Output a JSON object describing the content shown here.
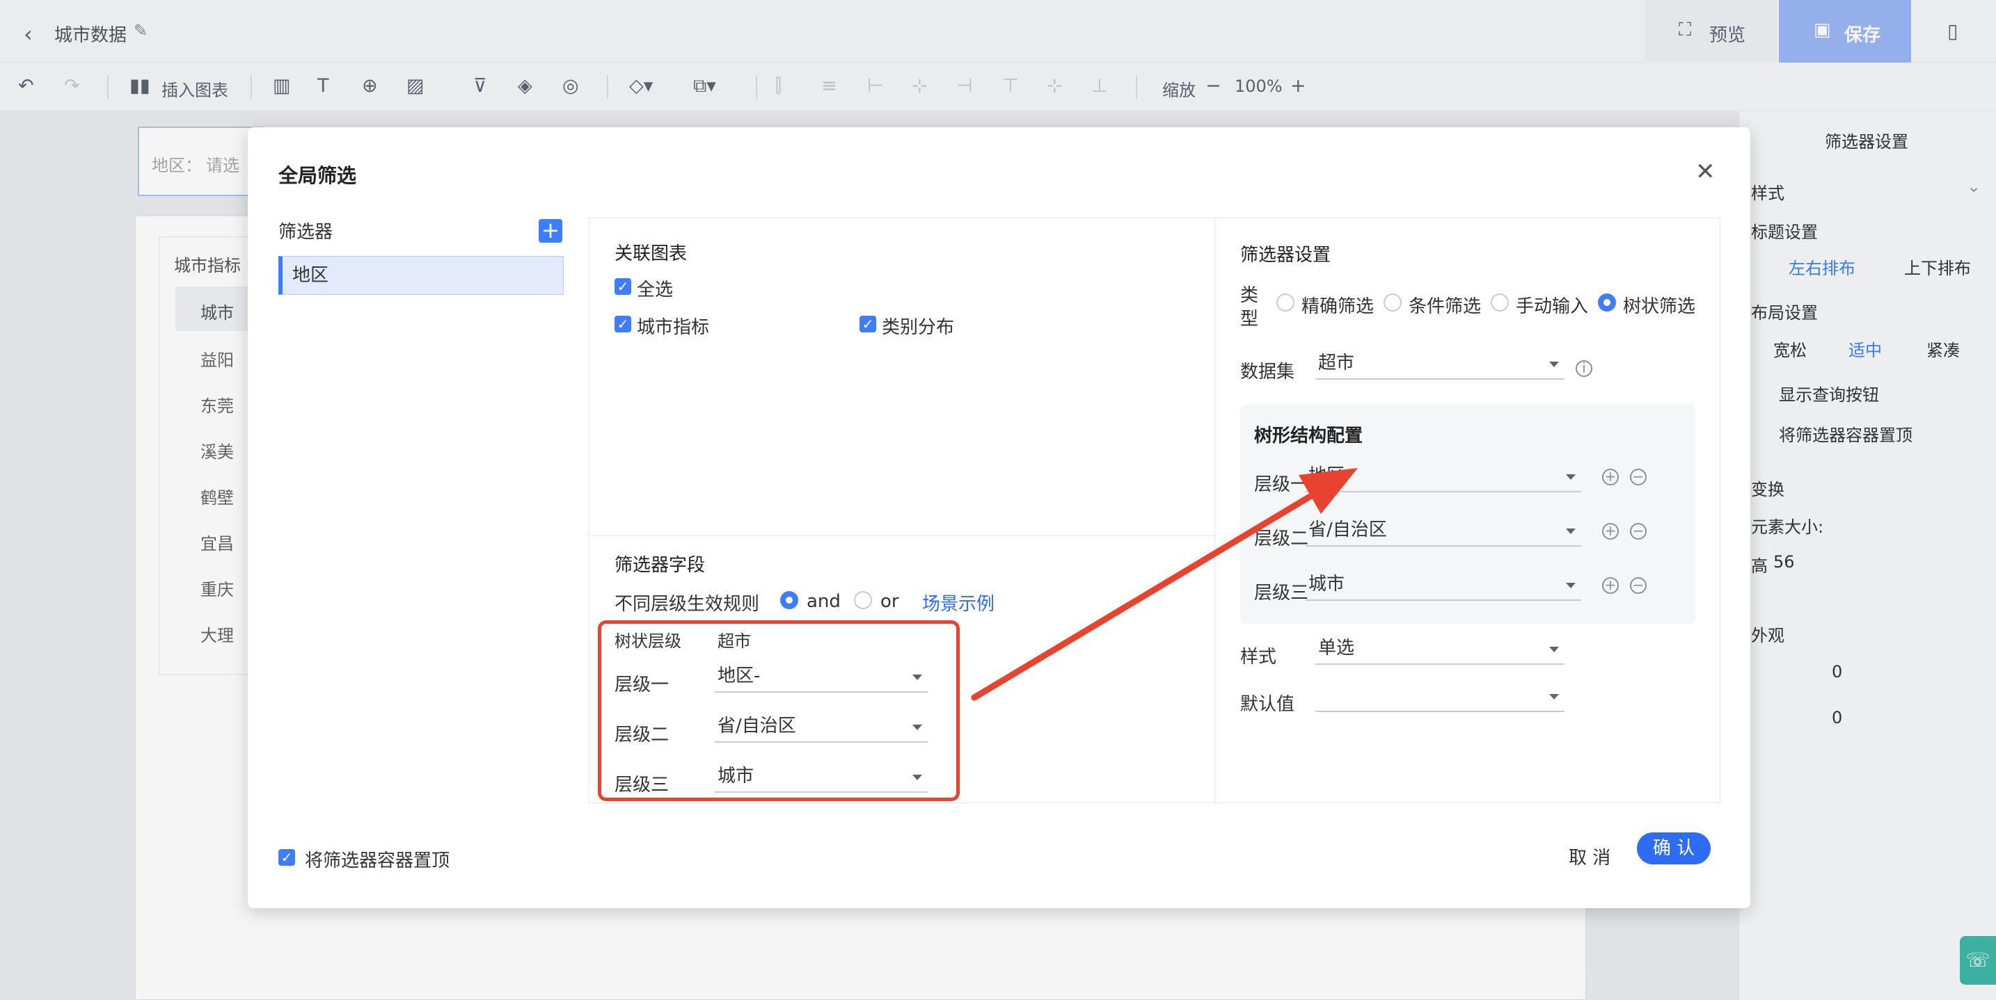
{
  "header": {
    "title": "城市数据",
    "preview": "预览",
    "save": "保存"
  },
  "toolbar": {
    "insert_chart": "插入图表",
    "zoom_label": "缩放",
    "zoom_value": "100%"
  },
  "canvas": {
    "filter_label": "地区：",
    "filter_placeholder": "请选",
    "table_title": "城市指标",
    "table_header": "城市",
    "rows": [
      "益阳",
      "东莞",
      "溪美",
      "鹤壁",
      "宜昌",
      "重庆",
      "大理"
    ]
  },
  "right_panel": {
    "title": "筛选器设置",
    "style_section": "样式",
    "title_setting": "标题设置",
    "title_opt1": "左右排布",
    "title_opt2": "上下排布",
    "layout_setting": "布局设置",
    "layout_opts": [
      "宽松",
      "适中",
      "紧凑"
    ],
    "show_query": "显示查询按钮",
    "pin_top": "将筛选器容器置顶",
    "transform": "变换",
    "element_size": "元素大小:",
    "height_label": "高",
    "height_value": "56",
    "appearance": "外观",
    "val1": "0",
    "val2": "0"
  },
  "modal": {
    "title": "全局筛选",
    "filter_list_label": "筛选器",
    "filter_item": "地区",
    "linked_charts": {
      "title": "关联图表",
      "select_all": "全选",
      "chart1": "城市指标",
      "chart2": "类别分布"
    },
    "fields": {
      "title": "筛选器字段",
      "rule_label": "不同层级生效规则",
      "and": "and",
      "or": "or",
      "example": "场景示例",
      "col1": "树状层级",
      "col2": "超市",
      "level1": "层级一",
      "level1_val": "地区-",
      "level2": "层级二",
      "level2_val": "省/自治区",
      "level3": "层级三",
      "level3_val": "城市"
    },
    "settings": {
      "title": "筛选器设置",
      "type_label1": "类",
      "type_label2": "型",
      "types": [
        "精确筛选",
        "条件筛选",
        "手动输入",
        "树状筛选"
      ],
      "dataset_label": "数据集",
      "dataset_value": "超市",
      "tree_title": "树形结构配置",
      "level1": "层级一",
      "level1_val": "地区-",
      "level2": "层级二",
      "level2_val": "省/自治区",
      "level3": "层级三",
      "level3_val": "城市",
      "style_label": "样式",
      "style_value": "单选",
      "default_label": "默认值",
      "default_value": ""
    },
    "pin_top": "将筛选器容器置顶",
    "cancel": "取 消",
    "confirm": "确 认"
  },
  "colors": {
    "accent": "#3f7dff",
    "highlight": "#e8432f"
  }
}
